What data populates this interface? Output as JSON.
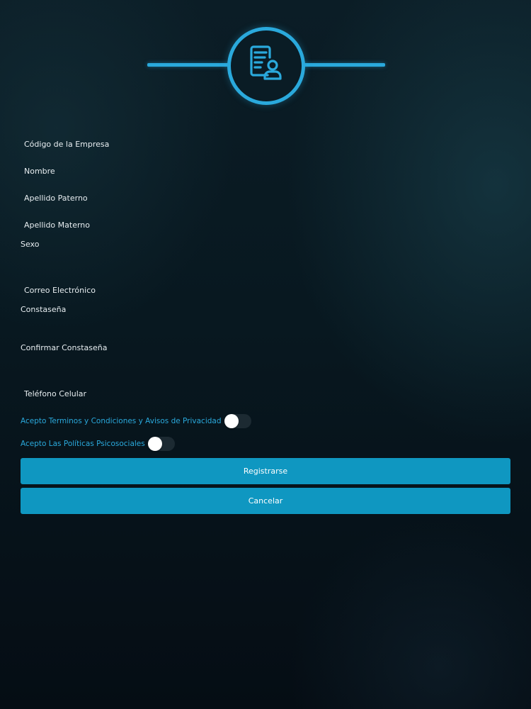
{
  "header": {
    "icon": "document-user-icon",
    "accent_color": "#2aa9dc"
  },
  "form": {
    "company_code_label": "Código de la Empresa",
    "first_name_label": "Nombre",
    "paternal_surname_label": "Apellido Paterno",
    "maternal_surname_label": "Apellido Materno",
    "sex_label": "Sexo",
    "email_label": "Correo Electrónico",
    "password_label": "Constaseña",
    "confirm_password_label": "Confirmar Constaseña",
    "phone_label": "Teléfono Celular"
  },
  "toggles": {
    "terms_label": "Acepto Terminos y Condiciones y Avisos de Privacidad",
    "terms_on": false,
    "psychosocial_label": "Acepto Las Políticas Psicosociales",
    "psychosocial_on": false
  },
  "buttons": {
    "register_label": "Registrarse",
    "cancel_label": "Cancelar",
    "button_color": "#0f97c1"
  }
}
